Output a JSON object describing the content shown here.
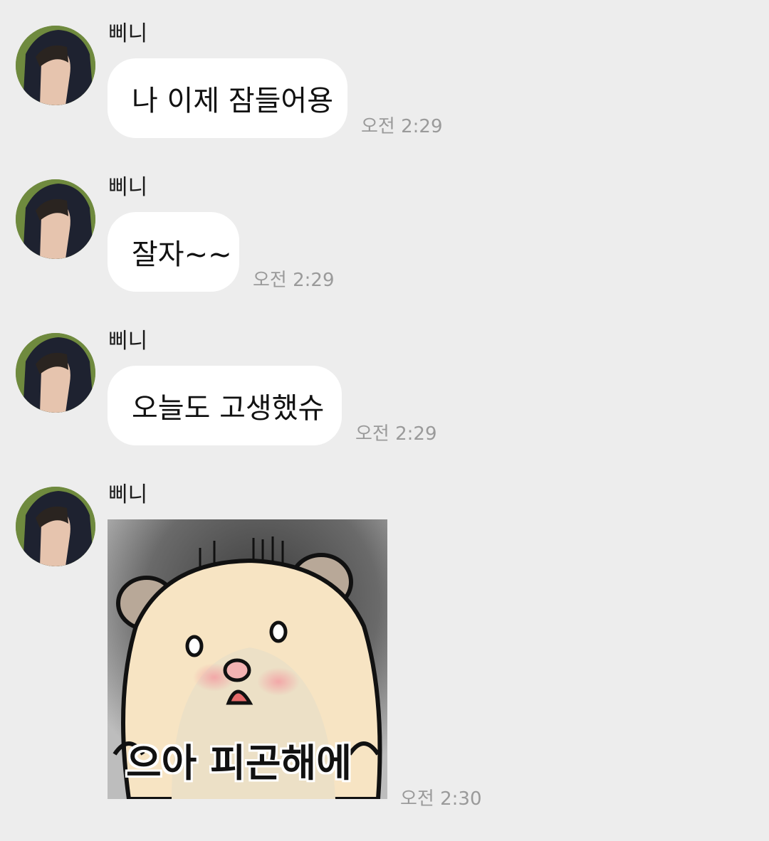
{
  "messages": [
    {
      "sender": "삐니",
      "text": "나 이제 잠들어용",
      "time": "오전 2:29"
    },
    {
      "sender": "삐니",
      "text": "잘자~~",
      "time": "오전 2:29"
    },
    {
      "sender": "삐니",
      "text": "오늘도 고생했슈",
      "time": "오전 2:29"
    },
    {
      "sender": "삐니",
      "sticker_caption": "으아 피곤해에",
      "time": "오전 2:30"
    }
  ],
  "colors": {
    "background": "#ededed",
    "bubble": "#ffffff",
    "time": "#9a9a9a"
  }
}
